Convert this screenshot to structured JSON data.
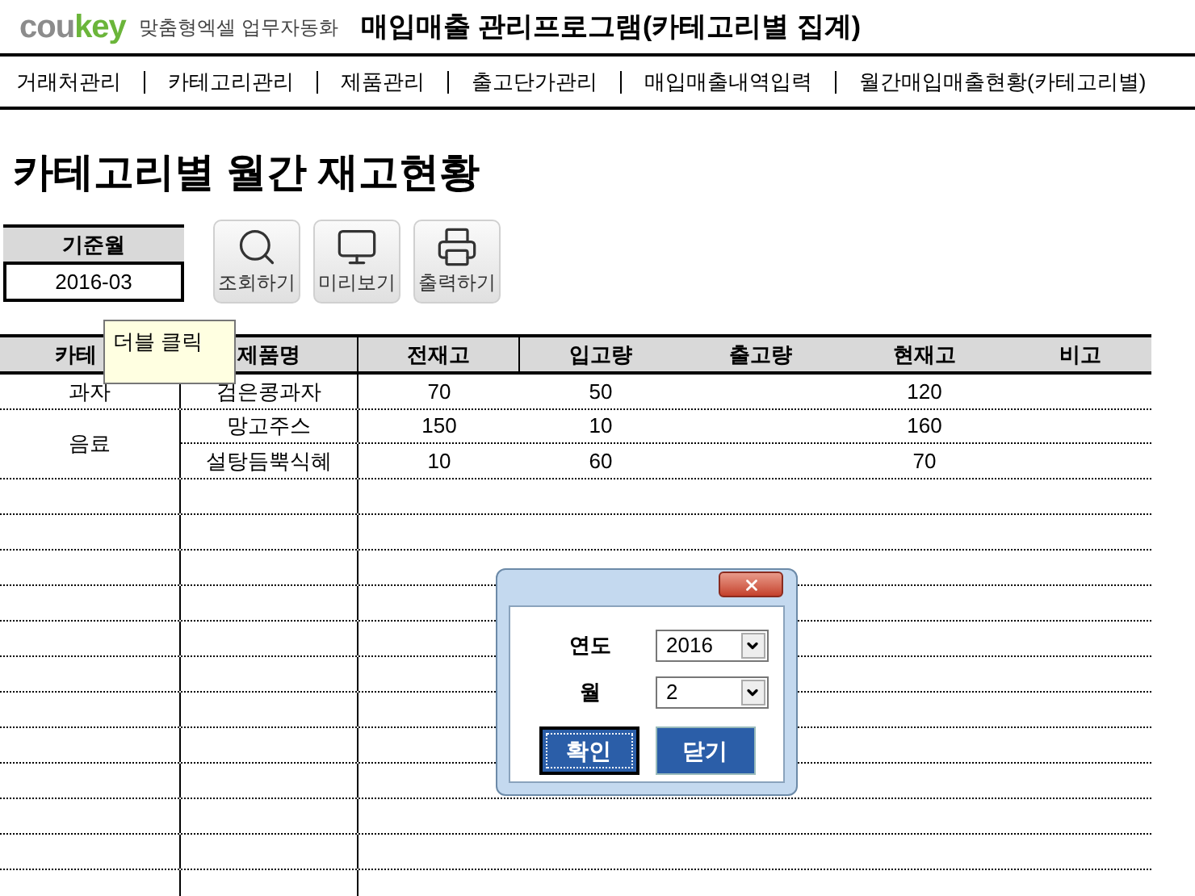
{
  "brand": {
    "logo_gray": "cou",
    "logo_green": "key",
    "tagline": "맞춤형엑셀 업무자동화",
    "title": "매입매출 관리프로그램(카테고리별 집계)"
  },
  "nav": [
    "거래처관리",
    "카테고리관리",
    "제품관리",
    "출고단가관리",
    "매입매출내역입력",
    "월간매입매출현황(카테고리별)"
  ],
  "page_title": "카테고리별 월간 재고현황",
  "base_month": {
    "label": "기준월",
    "value": "2016-03"
  },
  "actions": [
    {
      "kind": "search",
      "label": "조회하기"
    },
    {
      "kind": "preview",
      "label": "미리보기"
    },
    {
      "kind": "print",
      "label": "출력하기"
    }
  ],
  "tooltip": "더블 클릭",
  "table": {
    "columns": [
      "카테",
      "제품명",
      "전재고",
      "입고량",
      "출고량",
      "현재고",
      "비고"
    ],
    "groups": [
      {
        "category": "과자",
        "rows": [
          {
            "product": "검은콩과자",
            "previous": "70",
            "incoming": "50",
            "current": "120"
          }
        ]
      },
      {
        "category": "음료",
        "rows": [
          {
            "product": "망고주스",
            "previous": "150",
            "incoming": "10",
            "current": "160"
          },
          {
            "product": "설탕듬뿍식혜",
            "previous": "10",
            "incoming": "60",
            "current": "70"
          }
        ]
      }
    ]
  },
  "dialog": {
    "fields": [
      {
        "label": "연도",
        "value": "2016"
      },
      {
        "label": "월",
        "value": "2"
      }
    ],
    "buttons": [
      {
        "label": "확인",
        "focused": true
      },
      {
        "label": "닫기",
        "focused": false
      }
    ]
  }
}
